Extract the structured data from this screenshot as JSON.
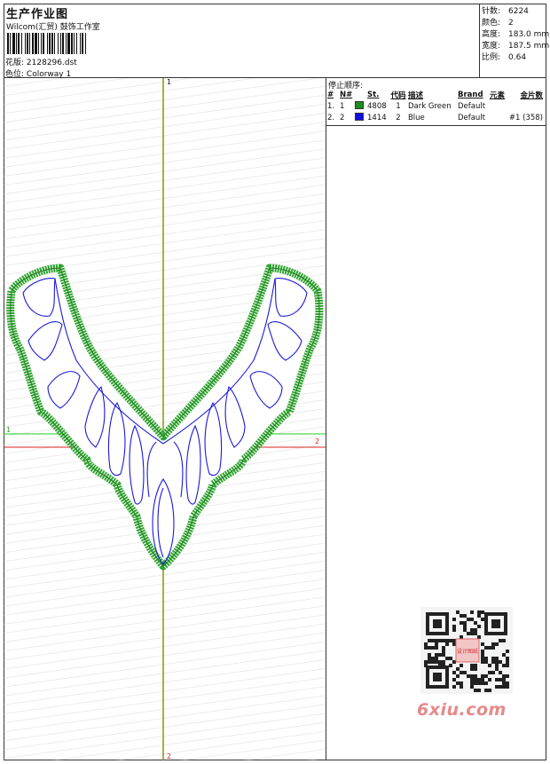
{
  "header": {
    "title": "生产作业图",
    "studio": "Wilcom(汇贸) 鼓饰工作室",
    "file_label": "花版:",
    "file_name": "2128296.dst",
    "colorway_label": "色位:",
    "colorway": "Colorway 1"
  },
  "info": {
    "stitches_label": "针数:",
    "stitches": "6224",
    "colors_label": "颜色:",
    "colors": "2",
    "height_label": "高度:",
    "height": "183.0 mm",
    "width_label": "宽度:",
    "width": "187.5 mm",
    "scale_label": "比例:",
    "scale": "0.64"
  },
  "stop_sequence": {
    "heading": "停止顺序:",
    "columns": [
      "#",
      "N#",
      "St.",
      "代码",
      "描述",
      "Brand",
      "元素",
      "金片数"
    ],
    "rows": [
      {
        "index": "1.",
        "n": "1",
        "color": "#1e8c1e",
        "code": "4808",
        "st": "1",
        "desc": "Dark Green",
        "brand": "Default",
        "sequin": ""
      },
      {
        "index": "2.",
        "n": "2",
        "color": "#1010e0",
        "code": "1414",
        "st": "2",
        "desc": "Blue",
        "brand": "Default",
        "sequin": "#1 (358)"
      }
    ]
  },
  "axes": {
    "v_top": "1",
    "v_bottom": "2",
    "h_green": "1",
    "h_red": "2"
  },
  "colors": {
    "green": "#2ea52e",
    "blue": "#1a1ad8",
    "axis_olive": "#8a8a00",
    "axis_green": "#22cc22",
    "axis_red": "#dd2222"
  },
  "watermark": "6xiu.com",
  "qr_stamp": "设计图纸"
}
